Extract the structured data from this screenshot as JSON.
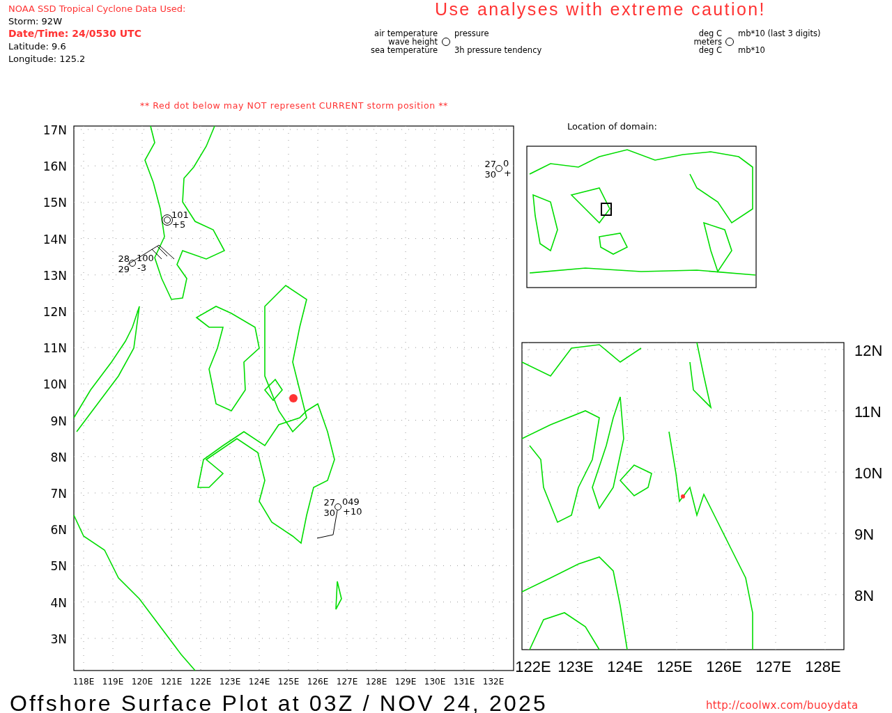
{
  "header": {
    "title": "NOAA SSD Tropical Cyclone Data Used:",
    "storm": "Storm: 92W",
    "datetime": "Date/Time: 24/0530 UTC",
    "latitude": "Latitude: 9.6",
    "longitude": "Longitude: 125.2"
  },
  "caution": "Use analyses with extreme caution!",
  "legend": {
    "left_top": "air temperature",
    "left_middle": "wave height",
    "left_bottom": "sea temperature",
    "right_top": "pressure",
    "right_bottom": "3h pressure tendency"
  },
  "units": {
    "left_top": "deg C",
    "left_middle": "meters",
    "left_bottom": "deg C",
    "right_top": "mb*10 (last 3 digits)",
    "right_bottom": "mb*10"
  },
  "note": "** Red dot below may NOT represent CURRENT storm position **",
  "main_map": {
    "lat_labels": [
      "17N",
      "16N",
      "15N",
      "14N",
      "13N",
      "12N",
      "11N",
      "10N",
      "9N",
      "8N",
      "7N",
      "6N",
      "5N",
      "4N",
      "3N"
    ],
    "lon_labels": [
      "118E",
      "119E",
      "120E",
      "121E",
      "122E",
      "123E",
      "124E",
      "125E",
      "126E",
      "127E",
      "128E",
      "129E",
      "130E",
      "131E",
      "132E"
    ],
    "stations": [
      {
        "kind": "buoy",
        "tr": "101",
        "br": "+5"
      },
      {
        "kind": "ship",
        "tl": "28",
        "tr": "100",
        "bl": "29",
        "br": "-3"
      },
      {
        "kind": "ship",
        "tl": "27",
        "tr": "049",
        "bl": "30",
        "br": "+10"
      },
      {
        "kind": "ship",
        "tl": "27",
        "tr": "0",
        "bl": "30",
        "br": "+"
      }
    ]
  },
  "domain_map": {
    "title": "Location of domain:"
  },
  "inset_map": {
    "lat_labels": [
      "12N",
      "11N",
      "10N",
      "9N",
      "8N"
    ],
    "lon_labels": [
      "122E",
      "123E",
      "124E",
      "125E",
      "126E",
      "127E",
      "128E"
    ]
  },
  "footer": {
    "title": "Offshore Surface Plot at 03Z / NOV 24, 2025",
    "url": "http://coolwx.com/buoydata"
  }
}
